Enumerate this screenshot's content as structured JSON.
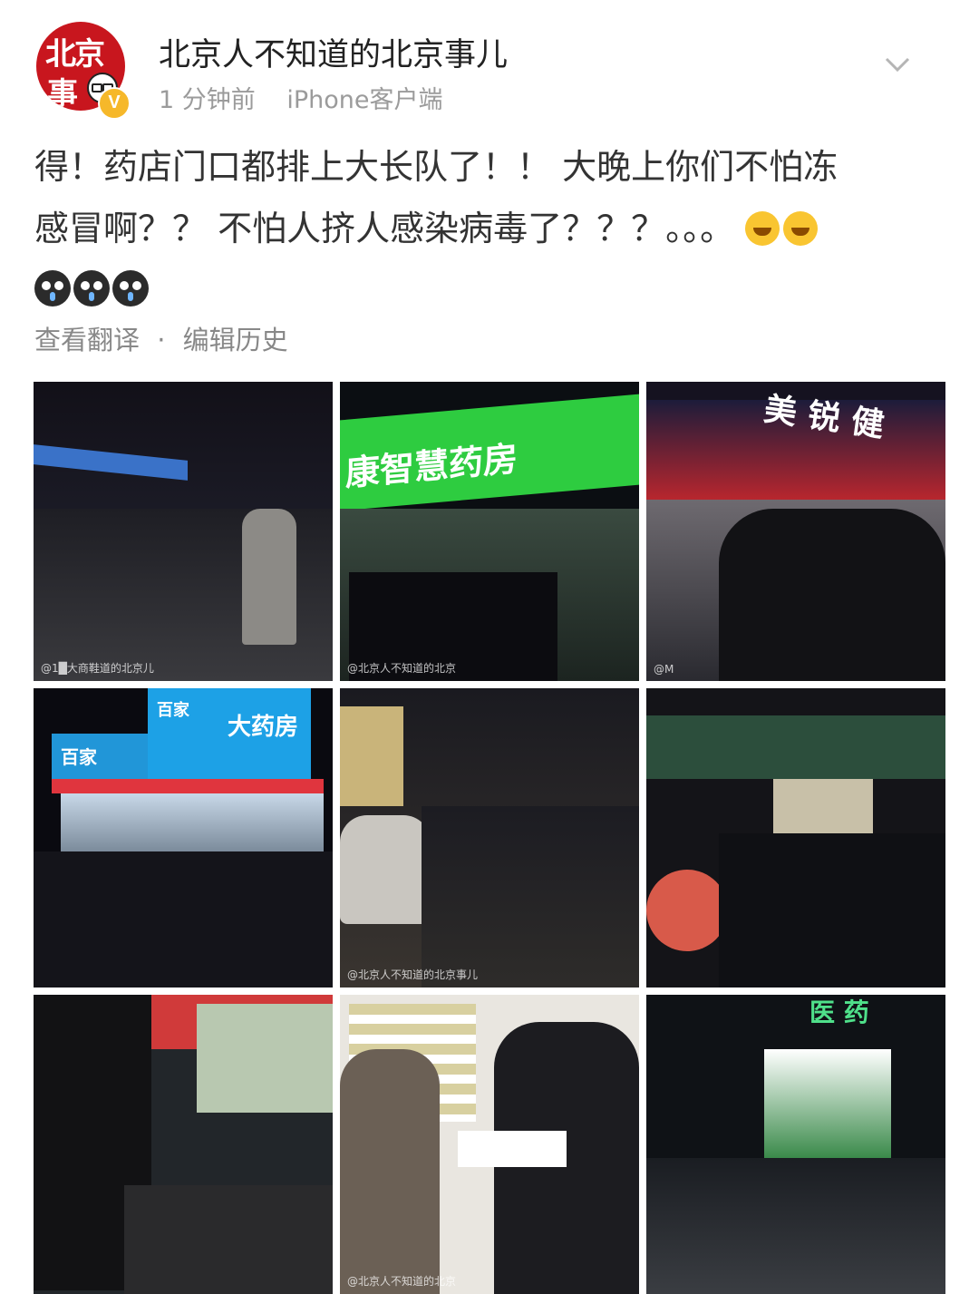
{
  "header": {
    "username": "北京人不知道的北京事儿",
    "time": "1 分钟前",
    "source": "iPhone客户端",
    "avatar_text_top": "北京",
    "avatar_text_bottom": "事",
    "verified_mark": "V",
    "brand_color": "#c8161e"
  },
  "post": {
    "line1": "得！药店门口都排上大长队了！！ 大晚上你们不怕冻",
    "line2": "感冒啊？？ 不怕人挤人感染病毒了？？？。。。",
    "emojis_line2": [
      "laugh-emoji",
      "laugh-emoji"
    ],
    "emojis_line3": [
      "cry-emoji",
      "cry-emoji",
      "cry-emoji"
    ]
  },
  "actions": {
    "translate": "查看翻译",
    "separator": "·",
    "history": "编辑历史"
  },
  "photos": [
    {
      "sign": "",
      "watermark": "@1█大商鞋道的北京儿"
    },
    {
      "sign": "康智慧药房",
      "watermark": "@北京人不知道的北京"
    },
    {
      "sign": "美 锐 健",
      "watermark": "@M"
    },
    {
      "sign": "大药房",
      "sign2": "百家",
      "sign3": "百家",
      "watermark": ""
    },
    {
      "sign": "",
      "watermark": "@北京人不知道的北京事儿"
    },
    {
      "sign": "",
      "watermark": ""
    },
    {
      "sign": "",
      "watermark": ""
    },
    {
      "sign": "",
      "watermark": "@北京人不知道的北京"
    },
    {
      "sign": "医 药",
      "watermark": ""
    }
  ]
}
